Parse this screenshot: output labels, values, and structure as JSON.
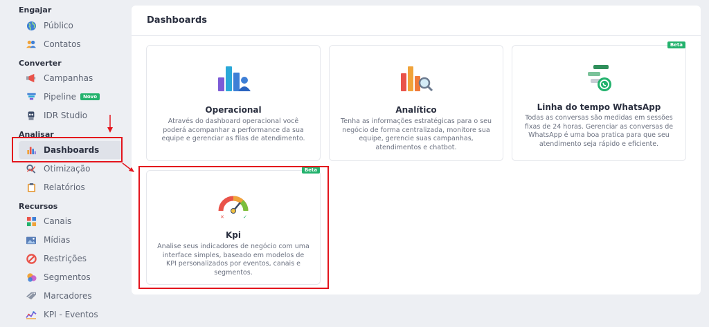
{
  "sidebar": {
    "sections": [
      {
        "title": "Engajar",
        "items": [
          {
            "label": "Público",
            "icon": "globe-icon"
          },
          {
            "label": "Contatos",
            "icon": "contacts-icon"
          }
        ]
      },
      {
        "title": "Converter",
        "items": [
          {
            "label": "Campanhas",
            "icon": "megaphone-icon"
          },
          {
            "label": "Pipeline",
            "icon": "funnel-icon",
            "badge": "Novo"
          },
          {
            "label": "IDR Studio",
            "icon": "robot-icon"
          }
        ]
      },
      {
        "title": "Analisar",
        "items": [
          {
            "label": "Dashboards",
            "icon": "bar-chart-icon",
            "active": true
          },
          {
            "label": "Otimização",
            "icon": "optimization-icon"
          },
          {
            "label": "Relatórios",
            "icon": "clipboard-icon"
          }
        ]
      },
      {
        "title": "Recursos",
        "items": [
          {
            "label": "Canais",
            "icon": "channels-icon"
          },
          {
            "label": "Mídias",
            "icon": "media-icon"
          },
          {
            "label": "Restrições",
            "icon": "restriction-icon"
          },
          {
            "label": "Segmentos",
            "icon": "segments-icon"
          },
          {
            "label": "Marcadores",
            "icon": "tag-icon"
          },
          {
            "label": "KPI - Eventos",
            "icon": "kpi-events-icon"
          }
        ]
      }
    ]
  },
  "main": {
    "title": "Dashboards",
    "cards": [
      {
        "title": "Operacional",
        "icon": "operational-chart-icon",
        "description": "Através do dashboard operacional você poderá acompanhar a performance da sua equipe e gerenciar as filas de atendimento."
      },
      {
        "title": "Analítico",
        "icon": "analytic-chart-icon",
        "description": "Tenha as informações estratégicas para o seu negócio de forma centralizada, monitore sua equipe, gerencie suas campanhas, atendimentos e chatbot."
      },
      {
        "title": "Linha do tempo WhatsApp",
        "icon": "whatsapp-timeline-icon",
        "badge": "Beta",
        "description": "Todas as conversas são medidas em sessões fixas de 24 horas. Gerenciar as conversas de WhatsApp é uma boa pratica para que seu atendimento seja rápido e eficiente."
      },
      {
        "title": "Kpi",
        "icon": "kpi-gauge-icon",
        "badge": "Beta",
        "description": "Analise seus indicadores de negócio com uma interface simples, baseado em modelos de KPI personalizados por eventos, canais e segmentos."
      }
    ]
  },
  "colors": {
    "accent": "#23b26d",
    "annotation": "#e3141c",
    "active_bg": "#dfe2e9"
  }
}
